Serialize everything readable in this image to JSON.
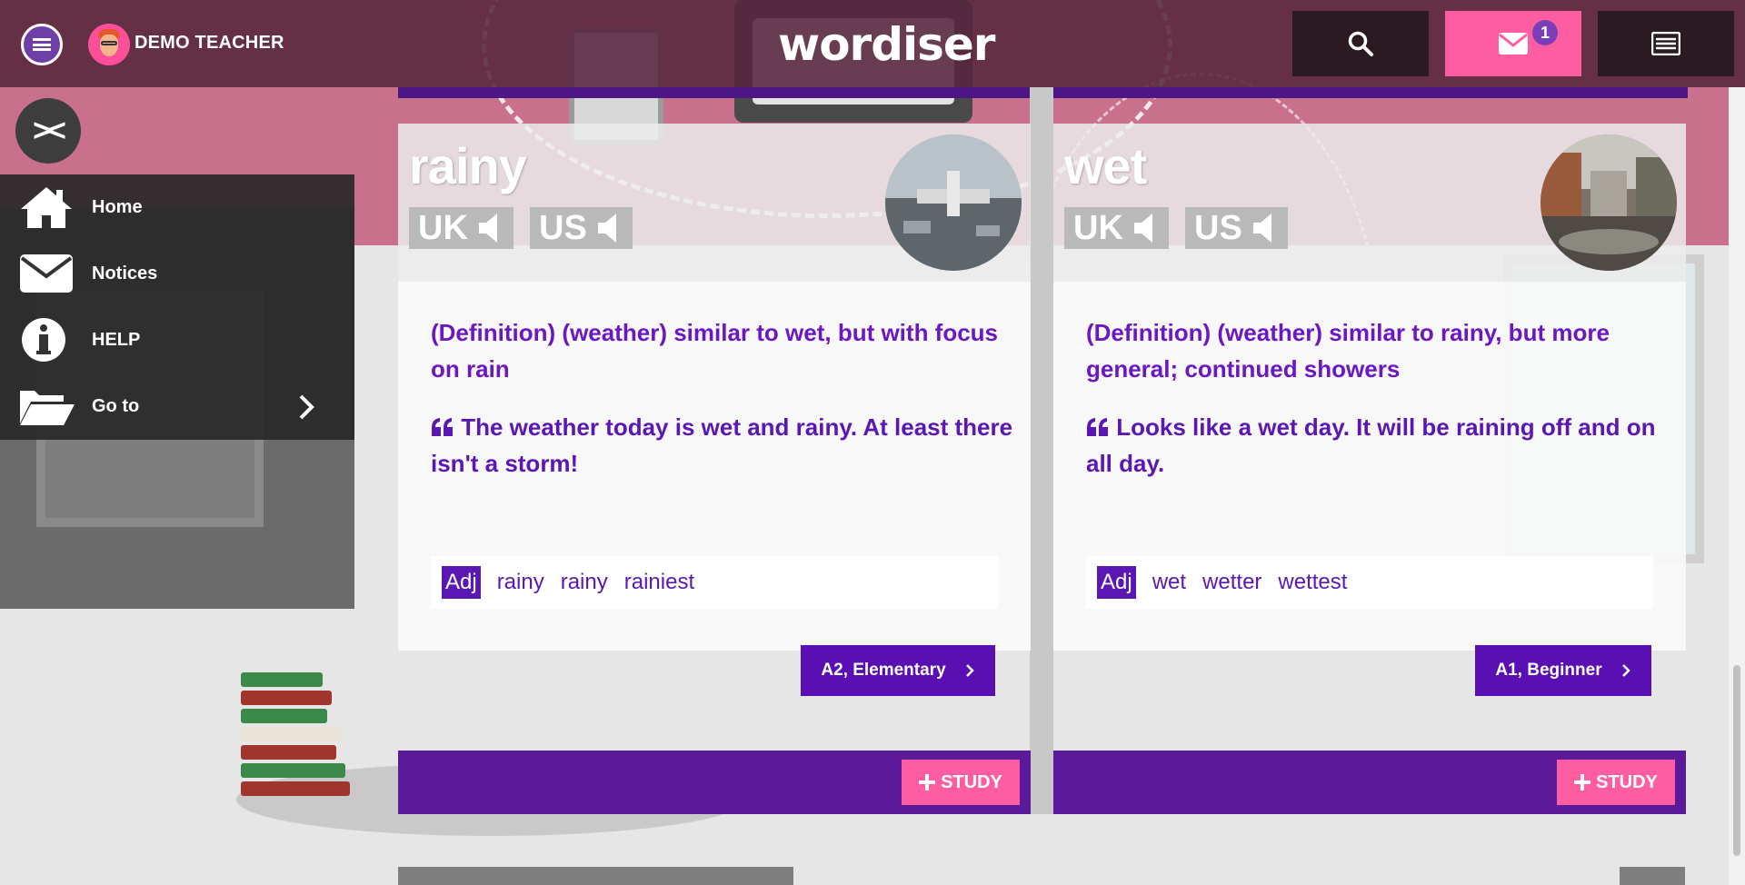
{
  "header": {
    "username": "DEMO TEACHER",
    "logo": "wordiser",
    "notification_count": "1",
    "icons": [
      "menu-icon",
      "avatar",
      "search-icon",
      "envelope-icon",
      "list-icon"
    ]
  },
  "sidebar": {
    "items": [
      {
        "label": "Home",
        "icon": "home-icon"
      },
      {
        "label": "Notices",
        "icon": "envelope-icon"
      },
      {
        "label": "HELP",
        "icon": "info-icon"
      },
      {
        "label": "Go to",
        "icon": "folder-open-icon"
      }
    ]
  },
  "cards": [
    {
      "word": "rainy",
      "uk_label": "UK",
      "us_label": "US",
      "definition": "(Definition) (weather) similar to wet, but with focus on rain",
      "example": "The weather today is wet and rainy. At least there isn't a storm!",
      "pos": "Adj",
      "forms": [
        "rainy",
        "rainy",
        "rainiest"
      ],
      "level": "A2, Elementary",
      "study_label": "STUDY"
    },
    {
      "word": "wet",
      "uk_label": "UK",
      "us_label": "US",
      "definition": "(Definition) (weather) similar to rainy, but more general; continued showers",
      "example": "Looks like a wet day. It will be raining off and on all day.",
      "pos": "Adj",
      "forms": [
        "wet",
        "wetter",
        "wettest"
      ],
      "level": "A1, Beginner",
      "study_label": "STUDY"
    }
  ],
  "colors": {
    "brand_purple": "#5a0fb4",
    "accent_pink": "#ff5da2",
    "text_purple": "#6b18c2"
  }
}
